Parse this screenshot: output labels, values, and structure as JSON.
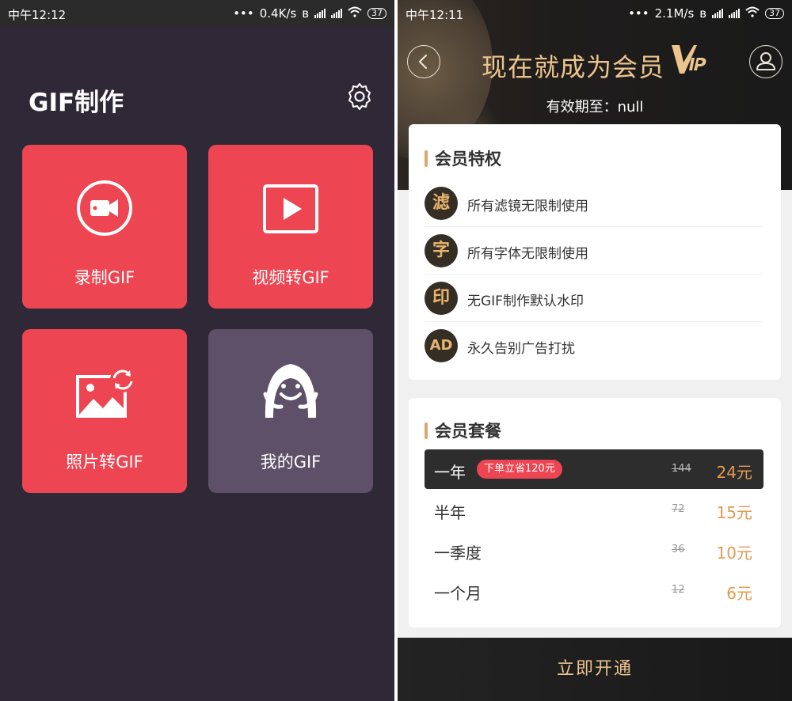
{
  "left": {
    "status": {
      "time": "中午12:12",
      "speed": "0.4K/s",
      "battery": "37"
    },
    "title": "GIF制作",
    "tiles": [
      {
        "label": "录制GIF",
        "icon": "video-camera-icon"
      },
      {
        "label": "视频转GIF",
        "icon": "play-icon"
      },
      {
        "label": "照片转GIF",
        "icon": "photo-convert-icon"
      },
      {
        "label": "我的GIF",
        "icon": "smiley-character-icon"
      }
    ]
  },
  "right": {
    "status": {
      "time": "中午12:11",
      "speed": "2.1M/s",
      "battery": "37"
    },
    "title": "现在就成为会员",
    "expire_label": "有效期至：null",
    "privileges": {
      "title": "会员特权",
      "items": [
        {
          "badge": "滤",
          "text": "所有滤镜无限制使用"
        },
        {
          "badge": "字",
          "text": "所有字体无限制使用"
        },
        {
          "badge": "印",
          "text": "无GIF制作默认水印"
        },
        {
          "badge": "AD",
          "text": "永久告别广告打扰"
        }
      ]
    },
    "packages": {
      "title": "会员套餐",
      "items": [
        {
          "name": "一年",
          "tag": "下单立省120元",
          "original": "144",
          "price": "24元"
        },
        {
          "name": "半年",
          "tag": "",
          "original": "72",
          "price": "15元"
        },
        {
          "name": "一季度",
          "tag": "",
          "original": "36",
          "price": "10元"
        },
        {
          "name": "一个月",
          "tag": "",
          "original": "12",
          "price": "6元"
        }
      ]
    },
    "open_button": "立即开通"
  },
  "colors": {
    "left_bg": "#2f2837",
    "tile_red": "#ed4551",
    "tile_purple": "#5d5068",
    "gold": "#ecc48e",
    "price": "#e29a4f"
  }
}
